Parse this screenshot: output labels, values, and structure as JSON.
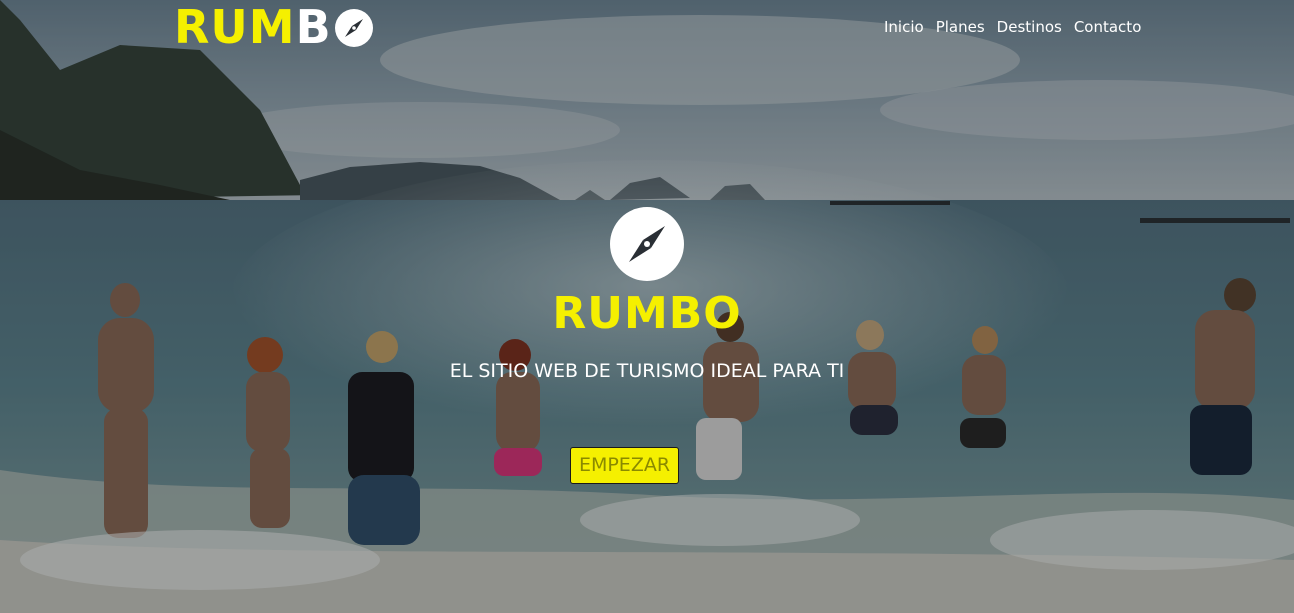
{
  "header": {
    "brand_part_a": "RUM",
    "brand_part_b": "B",
    "nav": [
      {
        "label": "Inicio"
      },
      {
        "label": "Planes"
      },
      {
        "label": "Destinos"
      },
      {
        "label": "Contacto"
      }
    ]
  },
  "hero": {
    "title": "RUMBO",
    "subtitle": "EL SITIO WEB DE TURISMO IDEAL PARA TI",
    "cta_label": "EMPEZAR"
  },
  "colors": {
    "accent": "#f5f000",
    "text_light": "#ffffff"
  },
  "icons": {
    "brand": "compass-icon",
    "center": "compass-icon"
  }
}
